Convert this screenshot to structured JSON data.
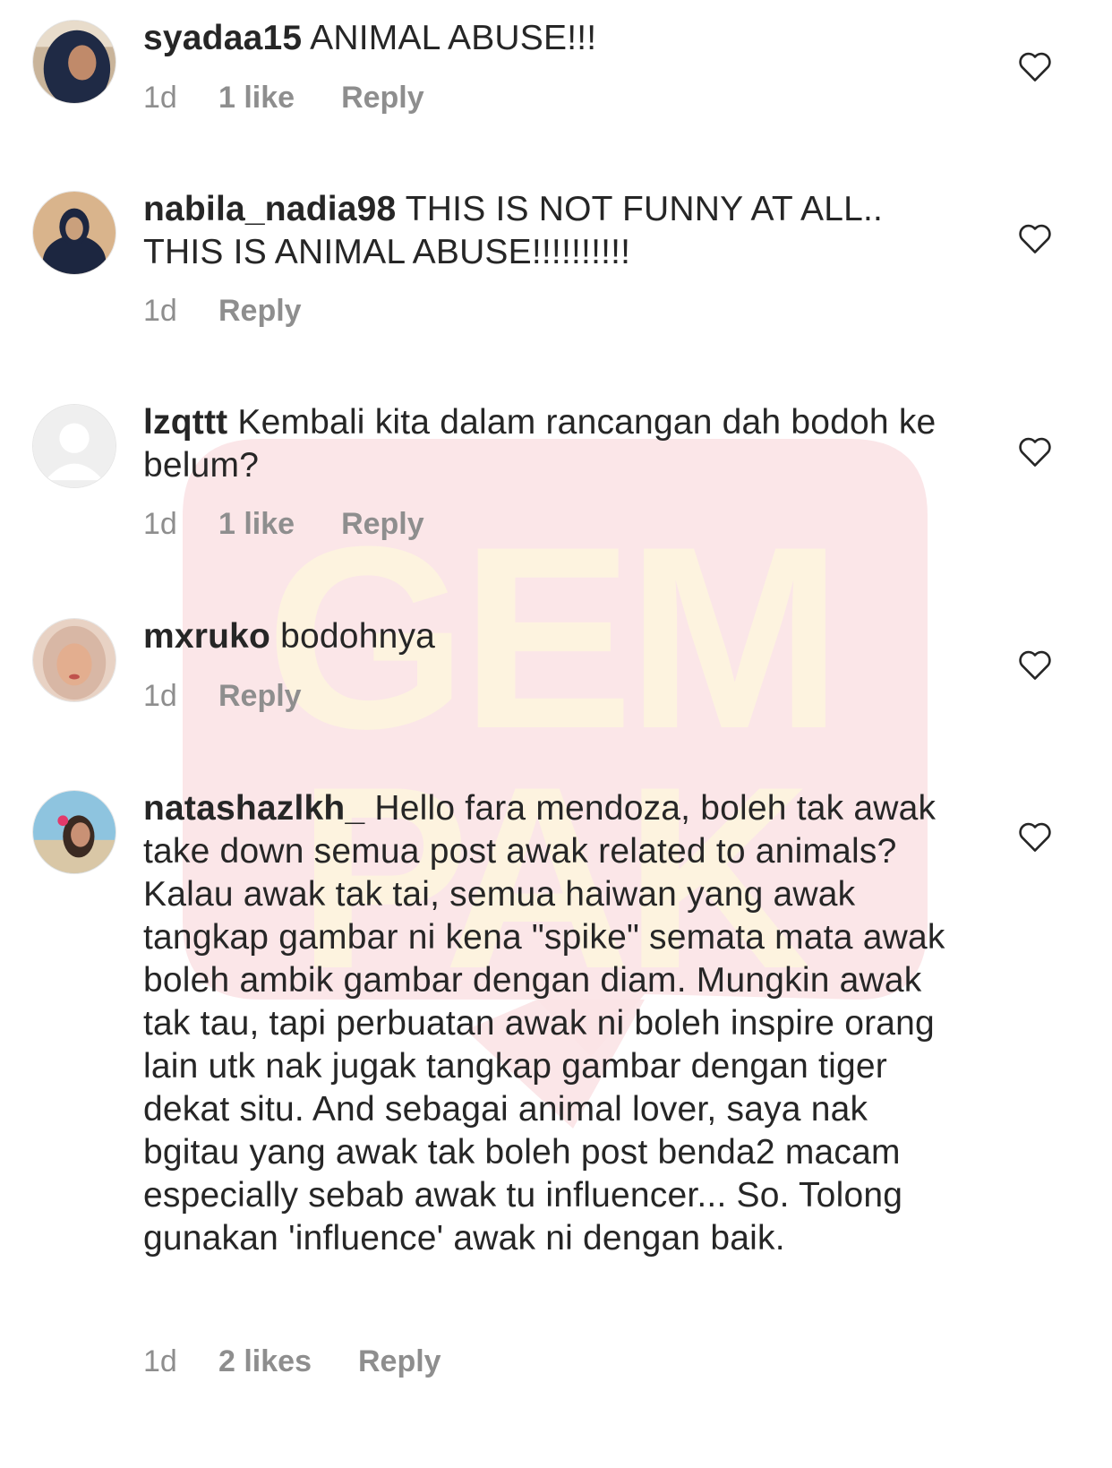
{
  "watermark": {
    "brand": "GEMPAK",
    "line1": "GEM",
    "line2": "PAK"
  },
  "comments": [
    {
      "username": "syadaa15",
      "text": "ANIMAL ABUSE!!!",
      "time": "1d",
      "likes": "1 like",
      "reply": "Reply"
    },
    {
      "username": "nabila_nadia98",
      "text": "THIS IS NOT FUNNY AT ALL.. THIS IS ANIMAL ABUSE!!!!!!!!!!",
      "time": "1d",
      "likes": "",
      "reply": "Reply"
    },
    {
      "username": "lzqttt",
      "text": "Kembali kita dalam rancangan dah bodoh ke belum?",
      "time": "1d",
      "likes": "1 like",
      "reply": "Reply"
    },
    {
      "username": "mxruko",
      "text": "bodohnya",
      "time": "1d",
      "likes": "",
      "reply": "Reply"
    },
    {
      "username": "natashazlkh_",
      "text": "Hello fara mendoza, boleh tak awak take down semua post awak related to animals? Kalau awak tak tai, semua haiwan yang awak tangkap gambar ni kena \"spike\" semata mata awak boleh ambik gambar dengan diam. Mungkin awak tak tau, tapi perbuatan awak ni boleh inspire orang lain utk nak jugak tangkap gambar dengan tiger dekat situ. And sebagai animal lover, saya nak bgitau yang awak tak boleh post benda2 macam especially sebab awak tu influencer... So. Tolong gunakan 'influence' awak ni dengan baik.",
      "time": "1d",
      "likes": "2 likes",
      "reply": "Reply"
    }
  ],
  "icons": {
    "like": "heart-outline-icon",
    "default_avatar": "default-avatar-icon"
  },
  "colors": {
    "text": "#262626",
    "meta": "#8e8e8e",
    "watermark_bg": "#fbe3e6",
    "watermark_text": "#fdf3df"
  }
}
